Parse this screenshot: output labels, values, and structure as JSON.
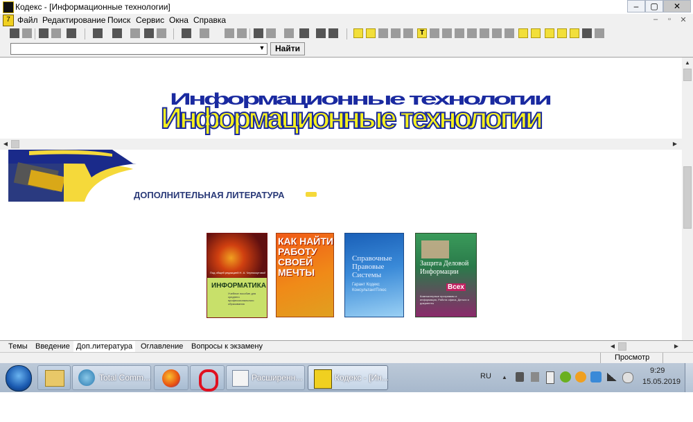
{
  "window": {
    "title": "Кодекс - [Информационные технологии]",
    "controls": [
      "–",
      "▢",
      "✕"
    ]
  },
  "menu": {
    "items": [
      "Файл",
      "Редактирование",
      "Поиск",
      "Сервис",
      "Окна",
      "Справка"
    ],
    "mdi_controls": [
      "–",
      "▫",
      "✕"
    ]
  },
  "search": {
    "value": "",
    "button": "Найти"
  },
  "banner": {
    "title": "Информационные технологии"
  },
  "section": {
    "heading": "ДОПОЛНИТЕЛЬНАЯ ЛИТЕРАТУРА"
  },
  "books": [
    {
      "title": "ИНФОРМАТИКА",
      "editor": "Под общей редакцией Н. А. Черноскутовой",
      "subtitle": "Учебное пособие для среднего профессионального образования",
      "colors": {
        "top": "#c0281e",
        "bottom": "#c8e06a"
      }
    },
    {
      "title": "КАК НАЙТИ РАБОТУ СВОЕЙ МЕЧТЫ",
      "colors": {
        "top": "#e84a18",
        "bottom": "#f08a18"
      }
    },
    {
      "title": "Справочные Правовые Системы",
      "subtitle": "Гарант Кодекс КонсультантПлюс",
      "colors": {
        "top": "#2a7ac8",
        "bottom": "#8cc8f0"
      }
    },
    {
      "title": "Защита Деловой Информации",
      "badge": "Всех",
      "subtitle": "Компьютерные программы и информация, Работа офиса, Деньги и документы",
      "colors": {
        "top": "#2a8a4a",
        "bottom": "#9a2a6a"
      }
    }
  ],
  "tabs": [
    "Темы",
    "Введение",
    "Доп.литература",
    "Оглавление",
    "Вопросы к экзамену"
  ],
  "active_tab": "Доп.литература",
  "status": {
    "mode": "Просмотр"
  },
  "taskbar": {
    "items": [
      {
        "label": "Total Comm..."
      },
      {
        "label": "Расширенн..."
      },
      {
        "label": "Кодекс - [Ин..."
      }
    ],
    "language": "RU",
    "time": "9:29",
    "date": "15.05.2019"
  }
}
